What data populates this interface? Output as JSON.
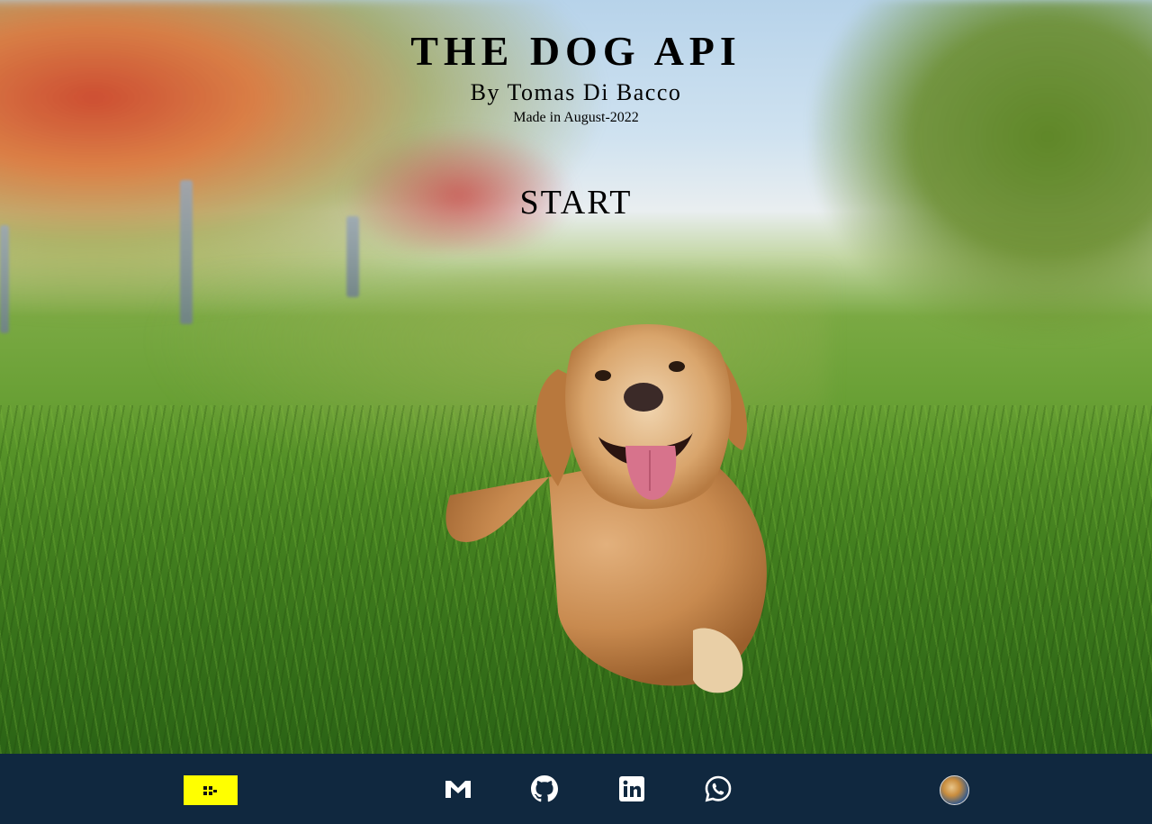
{
  "header": {
    "title": "THE DOG API",
    "byline": "By Tomas Di Bacco",
    "made": "Made in August-2022"
  },
  "hero": {
    "start_label": "START",
    "photo": "golden-retriever-lying-in-grass"
  },
  "footer": {
    "logo_icon": "henry-logo-icon",
    "logo_bg": "#ffff00",
    "bg": "#10283f",
    "social": [
      {
        "name": "gmail-icon"
      },
      {
        "name": "github-icon"
      },
      {
        "name": "linkedin-icon"
      },
      {
        "name": "whatsapp-icon"
      }
    ],
    "avatar": "profile-avatar"
  }
}
